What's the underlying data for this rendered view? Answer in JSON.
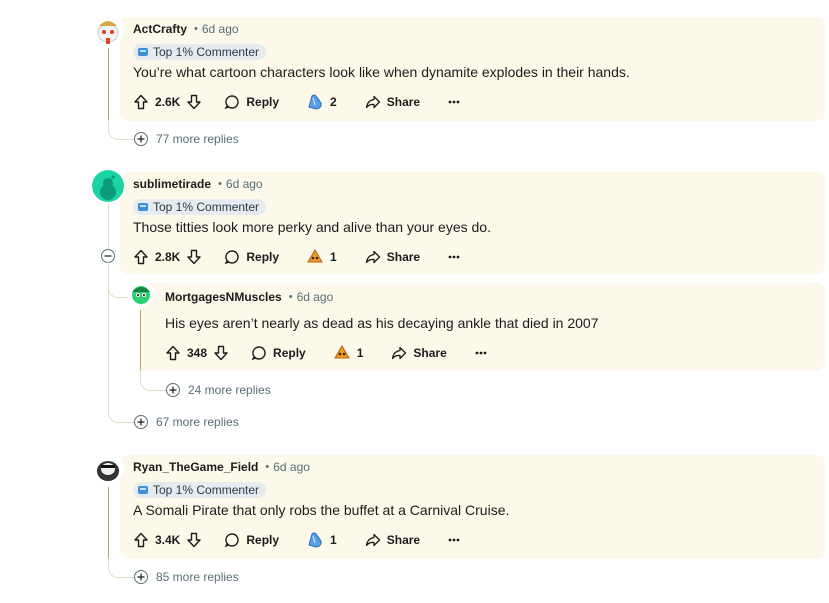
{
  "comments": [
    {
      "author": "ActCrafty",
      "time": "6d ago",
      "badge": "Top 1% Commenter",
      "text": "You’re what cartoon characters look like when dynamite explodes in their hands.",
      "votes": "2.6K",
      "reply_label": "Reply",
      "award_count": "2",
      "share_label": "Share",
      "more_replies": "77 more replies"
    },
    {
      "author": "sublimetirade",
      "time": "6d ago",
      "badge": "Top 1% Commenter",
      "text": "Those titties look more perky and alive than your eyes do.",
      "votes": "2.8K",
      "reply_label": "Reply",
      "award_count": "1",
      "share_label": "Share",
      "more_replies": "67 more replies",
      "reply": {
        "author": "MortgagesNMuscles",
        "time": "6d ago",
        "text": "His eyes aren’t nearly as dead as his decaying ankle that died in 2007",
        "votes": "348",
        "reply_label": "Reply",
        "award_count": "1",
        "share_label": "Share",
        "more_replies": "24 more replies"
      }
    },
    {
      "author": "Ryan_TheGame_Field",
      "time": "6d ago",
      "badge": "Top 1% Commenter",
      "text": "A Somali Pirate that only robs the buffet at a Carnival Cruise.",
      "votes": "3.4K",
      "reply_label": "Reply",
      "award_count": "1",
      "share_label": "Share",
      "more_replies": "85 more replies"
    }
  ],
  "colors": {
    "highlight": "#fcf8ea",
    "meta_gray": "#576f76",
    "badge_bg": "#e5ebee",
    "thread_gold": "#b8a462"
  },
  "icons": [
    "upvote-icon",
    "downvote-icon",
    "reply-bubble-icon",
    "award-icon",
    "share-arrow-icon",
    "overflow-menu-icon",
    "plus-circle-icon",
    "minus-circle-icon",
    "badge-icon"
  ]
}
